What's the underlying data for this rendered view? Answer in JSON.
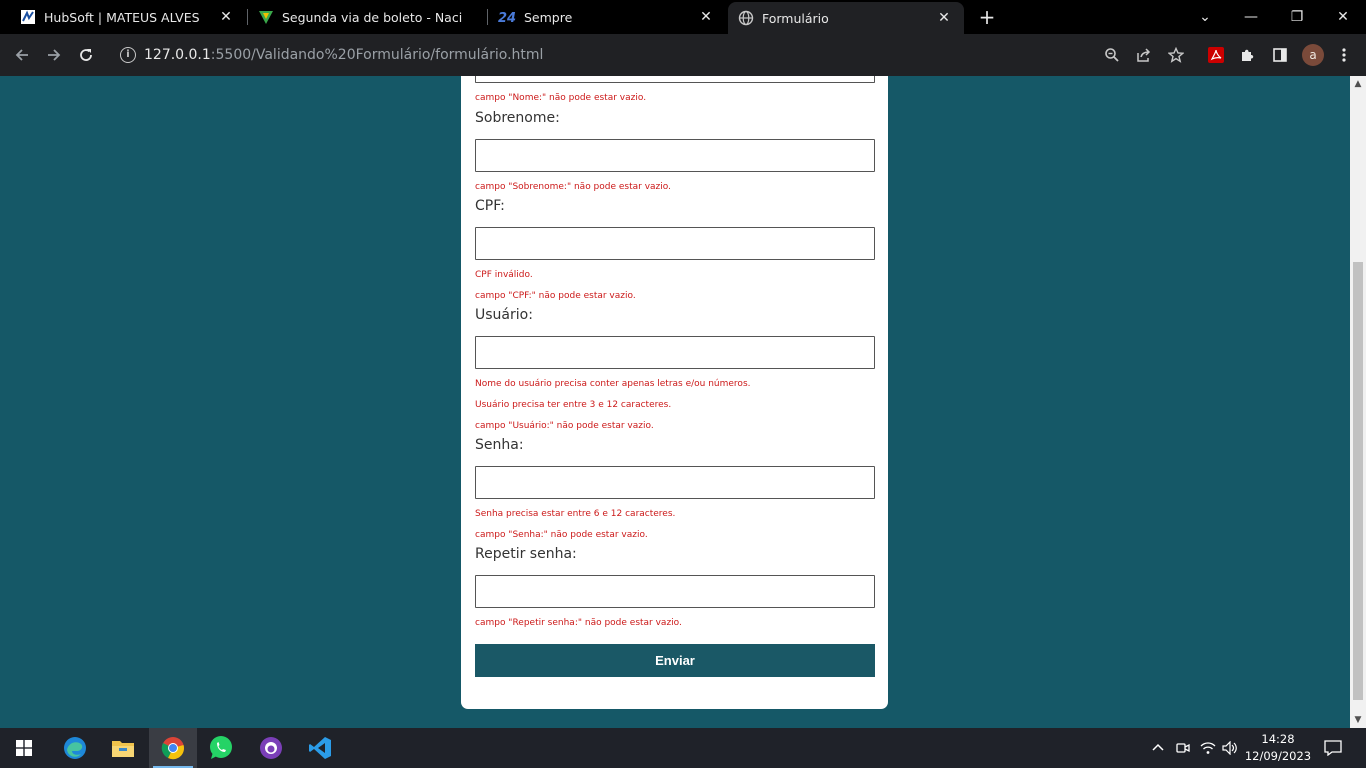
{
  "browser": {
    "tabs": [
      {
        "title": "HubSoft | MATEUS ALVES",
        "icon": "hubsoft-icon"
      },
      {
        "title": "Segunda via de boleto - Nacional",
        "icon": "nacional-icon"
      },
      {
        "title": "Sempre",
        "icon": "sempre-24-icon"
      },
      {
        "title": "Formulário",
        "icon": "globe-icon"
      }
    ],
    "url_host": "127.0.0.1",
    "url_rest": ":5500/Validando%20Formulário/formulário.html",
    "avatar_letter": "a"
  },
  "form": {
    "partial_error": "campo \"Nome:\" não pode estar vazio.",
    "fields": [
      {
        "label": "Sobrenome:",
        "errors": [
          "campo \"Sobrenome:\" não pode estar vazio."
        ]
      },
      {
        "label": "CPF:",
        "errors": [
          "CPF inválido.",
          "campo \"CPF:\" não pode estar vazio."
        ]
      },
      {
        "label": "Usuário:",
        "errors": [
          "Nome do usuário precisa conter apenas letras e/ou números.",
          "Usuário precisa ter entre 3 e 12 caracteres.",
          "campo \"Usuário:\" não pode estar vazio."
        ]
      },
      {
        "label": "Senha:",
        "errors": [
          "Senha precisa estar entre 6 e 12 caracteres.",
          "campo \"Senha:\" não pode estar vazio."
        ]
      },
      {
        "label": "Repetir senha:",
        "errors": [
          "campo \"Repetir senha:\" não pode estar vazio."
        ]
      }
    ],
    "submit_label": "Enviar"
  },
  "taskbar": {
    "time": "14:28",
    "date": "12/09/2023",
    "apps": [
      "edge-icon",
      "file-explorer-icon",
      "chrome-icon",
      "whatsapp-icon",
      "github-desktop-icon",
      "vscode-icon"
    ]
  },
  "colors": {
    "page_background": "#155867",
    "button": "#1a5866",
    "error": "#cc1a1a"
  }
}
